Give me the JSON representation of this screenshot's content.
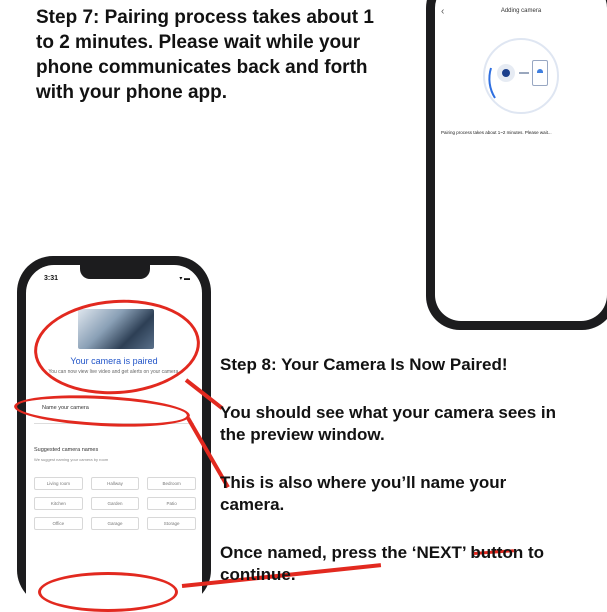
{
  "step7": {
    "text": "Step 7: Pairing process takes about 1 to 2 minutes. Please wait while your phone communicates back and forth with your phone app."
  },
  "phone_top": {
    "back_glyph": "‹",
    "title": "Adding camera",
    "message": "Pairing process takes about 1~2 minutes. Please wait..."
  },
  "phone_bottom": {
    "time": "3:31",
    "status": "▾ ▬",
    "paired_title": "Your camera is paired",
    "paired_sub": "You can now view live video and get alerts on your camera.",
    "name_label": "Name your camera",
    "suggested_title": "Suggested camera names",
    "suggested_sub": "We suggest naming your camera by room",
    "chips": [
      "Living room",
      "Hallway",
      "Bedroom",
      "Kitchen",
      "Garden",
      "Patio",
      "Office",
      "Garage",
      "Storage"
    ]
  },
  "step8": {
    "heading": "Step 8: Your Camera Is Now Paired!",
    "preview": "You should see what your camera sees in the preview window.",
    "name": "This is also where you’ll name your camera.",
    "next": "Once named, press the ‘NEXT’ button to continue."
  },
  "colors": {
    "annotation": "#e2291f",
    "accent": "#2255c8"
  }
}
